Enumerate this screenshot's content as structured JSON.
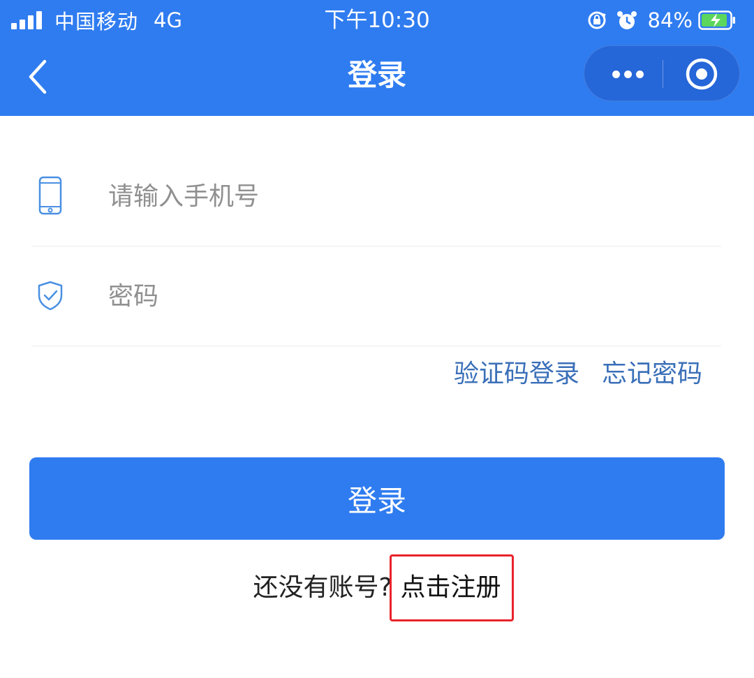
{
  "status_bar": {
    "carrier": "中国移动",
    "network": "4G",
    "time": "下午10:30",
    "battery": "84%"
  },
  "nav": {
    "title": "登录"
  },
  "form": {
    "phone_placeholder": "请输入手机号",
    "password_placeholder": "密码"
  },
  "links": {
    "sms_login": "验证码登录",
    "forgot_password": "忘记密码"
  },
  "login_button": "登录",
  "register": {
    "prompt": "还没有账号?",
    "link": "点击注册"
  },
  "colors": {
    "primary": "#2f7cf0",
    "link": "#3a6fb8",
    "highlight_box": "#e8232b"
  },
  "icons": {
    "phone": "mobile-phone-icon",
    "password": "shield-check-icon"
  }
}
